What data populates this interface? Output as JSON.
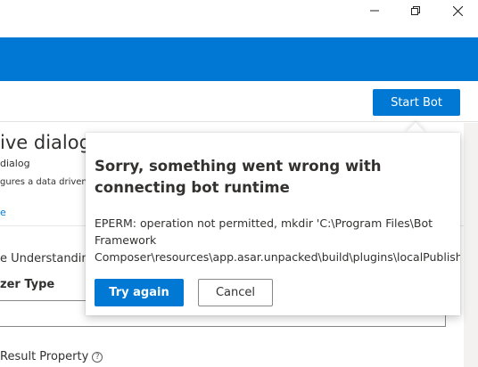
{
  "window": {
    "minimize_icon": "minimize-icon",
    "restore_icon": "restore-icon",
    "close_icon": "close-icon"
  },
  "toolbar": {
    "start_bot_label": "Start Bot"
  },
  "page": {
    "title": "ive dialog",
    "subtitle": "dialog",
    "description": "gures a data driven",
    "link": "e",
    "section": "e Understanding",
    "field_label": "zer Type",
    "result_property": "Result Property"
  },
  "callout": {
    "title": "Sorry, something went wrong with connecting bot runtime",
    "body_lines": [
      "EPERM: operation not permitted, mkdir 'C:\\Program Files\\Bot",
      "Framework",
      "Composer\\resources\\app.asar.unpacked\\build\\plugins\\localPublish"
    ],
    "try_again_label": "Try again",
    "cancel_label": "Cancel"
  },
  "colors": {
    "accent": "#0078d4",
    "text": "#323130"
  }
}
